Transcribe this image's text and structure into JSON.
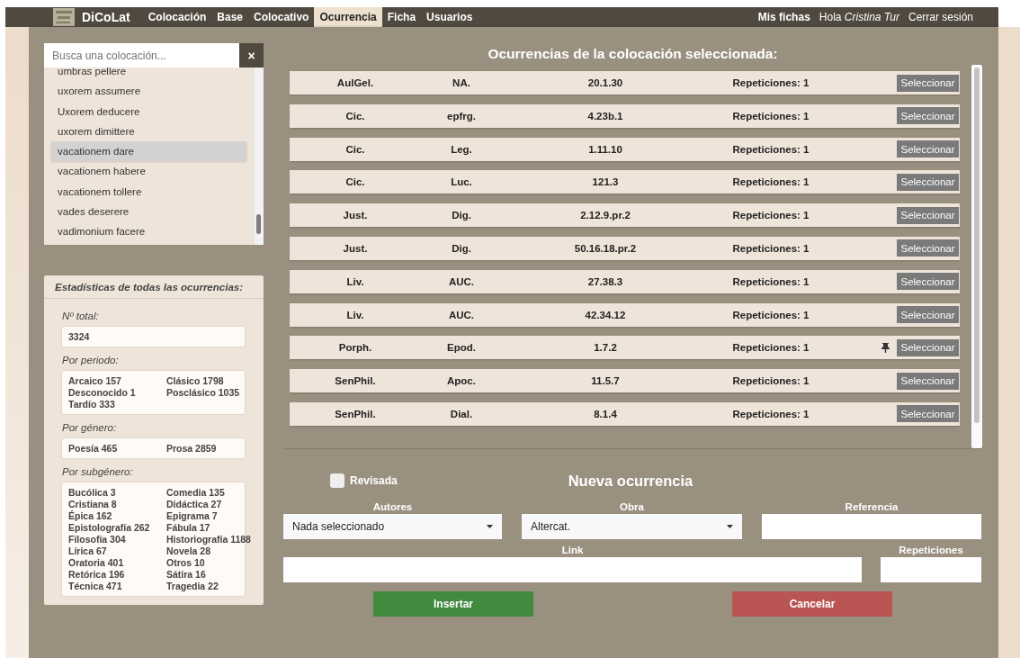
{
  "nav": {
    "logo_text": "DiCoLat",
    "items": [
      {
        "label": "Colocación",
        "selected": false
      },
      {
        "label": "Base",
        "selected": false
      },
      {
        "label": "Colocativo",
        "selected": false
      },
      {
        "label": "Ocurrencia",
        "selected": true
      },
      {
        "label": "Ficha",
        "selected": false
      },
      {
        "label": "Usuarios",
        "selected": false
      }
    ],
    "right": {
      "my_cards": "Mis fichas",
      "greeting": "Hola",
      "user": "Cristina Tur",
      "logout": "Cerrar sesión"
    }
  },
  "search": {
    "placeholder": "Busca una colocación...",
    "clear": "×"
  },
  "collocations": [
    {
      "label": "umbras pellere",
      "selected": false
    },
    {
      "label": "uxorem assumere",
      "selected": false
    },
    {
      "label": "Uxorem deducere",
      "selected": false
    },
    {
      "label": "uxorem dimittere",
      "selected": false
    },
    {
      "label": "vacationem dare",
      "selected": true
    },
    {
      "label": "vacationem habere",
      "selected": false
    },
    {
      "label": "vacationem tollere",
      "selected": false
    },
    {
      "label": "vades deserere",
      "selected": false
    },
    {
      "label": "vadimonium facere",
      "selected": false
    }
  ],
  "stats": {
    "title": "Estadísticas de todas las ocurrencias:",
    "total_label": "Nº total:",
    "total": "3324",
    "groups": [
      {
        "label": "Por periodo:",
        "items": [
          "Arcaico 157",
          "Clásico 1798",
          "Desconocido 1",
          "Posclásico 1035",
          "Tardío 333"
        ]
      },
      {
        "label": "Por género:",
        "items": [
          "Poesía 465",
          "Prosa 2859"
        ]
      },
      {
        "label": "Por subgénero:",
        "items": [
          "Bucólica 3",
          "Comedia 135",
          "Cristiana 8",
          "Didáctica 27",
          "Épica 162",
          "Epigrama 7",
          "Epistolografía 262",
          "Fábula 17",
          "Filosofía 304",
          "Historiografía 1188",
          "Lírica 67",
          "Novela 28",
          "Oratoria 401",
          "Otros 10",
          "Retórica 196",
          "Sátira 16",
          "Técnica 471",
          "Tragedia 22"
        ]
      }
    ]
  },
  "occurrences": {
    "title": "Ocurrencias de la colocación seleccionada:",
    "rows": [
      {
        "author": "AulGel.",
        "work": "NA.",
        "reference": "20.1.30",
        "repetitions": "Repeticiones: 1",
        "pinned": false,
        "button": "Seleccionar"
      },
      {
        "author": "Cic.",
        "work": "epfrg.",
        "reference": "4.23b.1",
        "repetitions": "Repeticiones: 1",
        "pinned": false,
        "button": "Seleccionar"
      },
      {
        "author": "Cic.",
        "work": "Leg.",
        "reference": "1.11.10",
        "repetitions": "Repeticiones: 1",
        "pinned": false,
        "button": "Seleccionar"
      },
      {
        "author": "Cic.",
        "work": "Luc.",
        "reference": "121.3",
        "repetitions": "Repeticiones: 1",
        "pinned": false,
        "button": "Seleccionar"
      },
      {
        "author": "Just.",
        "work": "Dig.",
        "reference": "2.12.9.pr.2",
        "repetitions": "Repeticiones: 1",
        "pinned": false,
        "button": "Seleccionar"
      },
      {
        "author": "Just.",
        "work": "Dig.",
        "reference": "50.16.18.pr.2",
        "repetitions": "Repeticiones: 1",
        "pinned": false,
        "button": "Seleccionar"
      },
      {
        "author": "Liv.",
        "work": "AUC.",
        "reference": "27.38.3",
        "repetitions": "Repeticiones: 1",
        "pinned": false,
        "button": "Seleccionar"
      },
      {
        "author": "Liv.",
        "work": "AUC.",
        "reference": "42.34.12",
        "repetitions": "Repeticiones: 1",
        "pinned": false,
        "button": "Seleccionar"
      },
      {
        "author": "Porph.",
        "work": "Epod.",
        "reference": "1.7.2",
        "repetitions": "Repeticiones: 1",
        "pinned": true,
        "button": "Seleccionar"
      },
      {
        "author": "SenPhil.",
        "work": "Apoc.",
        "reference": "11.5.7",
        "repetitions": "Repeticiones: 1",
        "pinned": false,
        "button": "Seleccionar"
      },
      {
        "author": "SenPhil.",
        "work": "Dial.",
        "reference": "8.1.4",
        "repetitions": "Repeticiones: 1",
        "pinned": false,
        "button": "Seleccionar"
      }
    ]
  },
  "form": {
    "reviewed": {
      "label": "Revisada",
      "checked": false
    },
    "title": "Nueva ocurrencia",
    "authors": {
      "label": "Autores",
      "value": "Nada seleccionado"
    },
    "work": {
      "label": "Obra",
      "value": "Altercat."
    },
    "reference": {
      "label": "Referencia"
    },
    "link": {
      "label": "Link"
    },
    "repetitions": {
      "label": "Repeticiones"
    },
    "insert": "Insertar",
    "cancel": "Cancelar"
  }
}
